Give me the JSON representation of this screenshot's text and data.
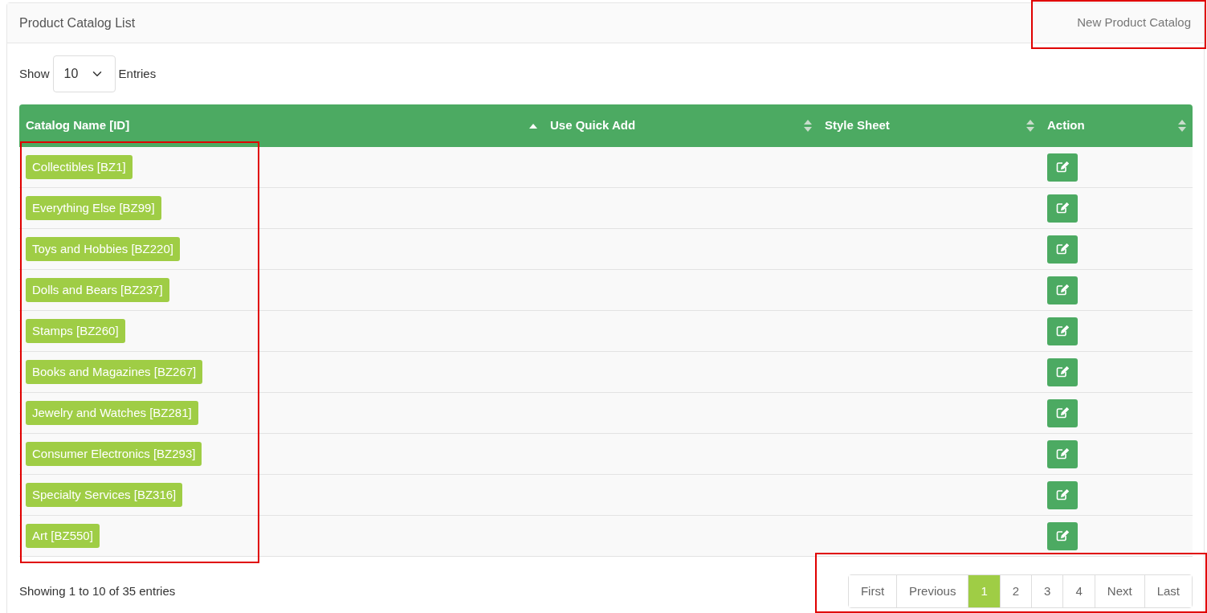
{
  "panel": {
    "title": "Product Catalog List",
    "action": "New Product Catalog"
  },
  "length_menu": {
    "prefix": "Show",
    "value": "10",
    "suffix": "Entries"
  },
  "table": {
    "columns": [
      {
        "label": "Catalog Name [ID]",
        "sorted": true
      },
      {
        "label": "Use Quick Add",
        "sorted": false
      },
      {
        "label": "Style Sheet",
        "sorted": false
      },
      {
        "label": "Action",
        "sorted": false
      }
    ],
    "rows": [
      {
        "name": "Collectibles [BZ1]"
      },
      {
        "name": "Everything Else [BZ99]"
      },
      {
        "name": "Toys and Hobbies [BZ220]"
      },
      {
        "name": "Dolls and Bears [BZ237]"
      },
      {
        "name": "Stamps [BZ260]"
      },
      {
        "name": "Books and Magazines [BZ267]"
      },
      {
        "name": "Jewelry and Watches [BZ281]"
      },
      {
        "name": "Consumer Electronics [BZ293]"
      },
      {
        "name": "Specialty Services [BZ316]"
      },
      {
        "name": "Art [BZ550]"
      }
    ]
  },
  "info": "Showing 1 to 10 of 35 entries",
  "pagination": [
    {
      "label": "First",
      "selected": false
    },
    {
      "label": "Previous",
      "selected": false
    },
    {
      "label": "1",
      "selected": true
    },
    {
      "label": "2",
      "selected": false
    },
    {
      "label": "3",
      "selected": false
    },
    {
      "label": "4",
      "selected": false
    },
    {
      "label": "Next",
      "selected": false
    },
    {
      "label": "Last",
      "selected": false
    }
  ]
}
